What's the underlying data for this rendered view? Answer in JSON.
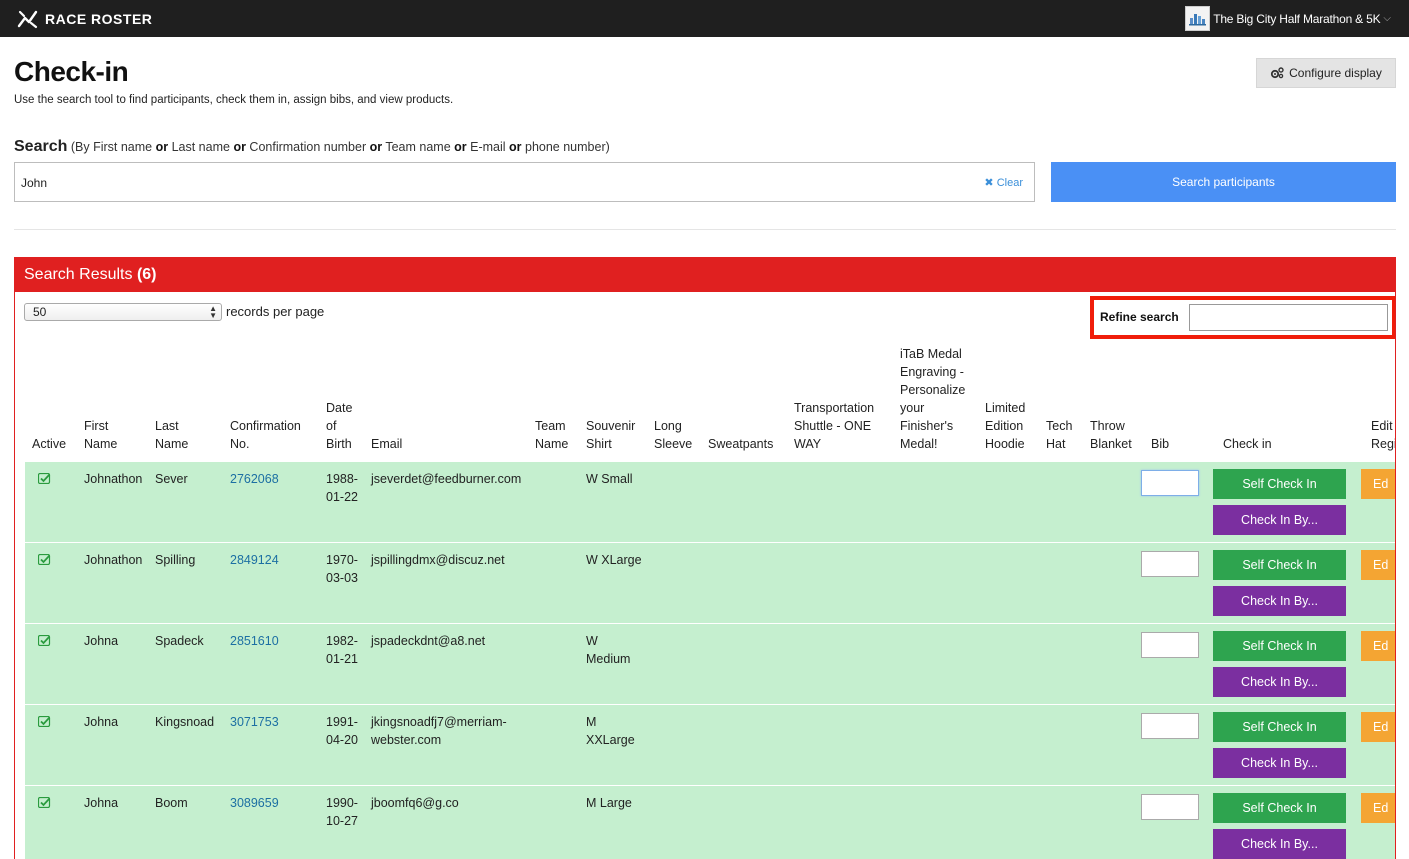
{
  "topbar": {
    "brand": "RACE ROSTER",
    "event_name": "The Big City Half Marathon & 5K",
    "caret": "⌵"
  },
  "header": {
    "title": "Check-in",
    "subtitle": "Use the search tool to find participants, check them in, assign bibs, and view products.",
    "configure_label": "Configure display"
  },
  "search": {
    "label": "Search",
    "hint_parts": [
      "(By First name ",
      "or",
      " Last name ",
      "or",
      " Confirmation number ",
      "or",
      " Team name ",
      "or",
      " E-mail ",
      "or",
      " phone number)"
    ],
    "value": "John",
    "clear_label": "Clear",
    "button_label": "Search participants"
  },
  "results": {
    "title": "Search Results",
    "count": "(6)",
    "per_page_value": "50",
    "per_page_label": "records per page",
    "refine_label": "Refine search",
    "refine_value": ""
  },
  "columns": {
    "active": "Active",
    "first_name": [
      "First",
      "Name"
    ],
    "last_name": [
      "Last",
      "Name"
    ],
    "confirmation": [
      "Confirmation",
      "No."
    ],
    "dob": [
      "Date",
      "of",
      "Birth"
    ],
    "email": "Email",
    "team_name": [
      "Team",
      "Name"
    ],
    "souvenir_shirt": [
      "Souvenir",
      "Shirt"
    ],
    "long_sleeve": [
      "Long",
      "Sleeve"
    ],
    "sweatpants": "Sweatpants",
    "transportation": [
      "Transportation",
      "Shuttle - ONE",
      "WAY"
    ],
    "itab_medal": [
      "iTaB Medal",
      "Engraving -",
      "Personalize",
      "your",
      "Finisher's",
      "Medal!"
    ],
    "limited_hoodie": [
      "Limited",
      "Edition",
      "Hoodie"
    ],
    "tech_hat": [
      "Tech",
      "Hat"
    ],
    "throw_blanket": [
      "Throw",
      "Blanket"
    ],
    "bib": "Bib",
    "check_in": "Check in",
    "edit_reg": [
      "Edit",
      "Regi"
    ]
  },
  "buttons": {
    "self_check_in": "Self Check In",
    "check_in_by": "Check In By...",
    "edit": "Ed"
  },
  "rows": [
    {
      "first": "Johnathon",
      "last": "Sever",
      "conf": "2762068",
      "dob": [
        "1988-",
        "01-22"
      ],
      "email": [
        "jseverdet@feedburner.com"
      ],
      "shirt": [
        "W Small"
      ]
    },
    {
      "first": "Johnathon",
      "last": "Spilling",
      "conf": "2849124",
      "dob": [
        "1970-",
        "03-03"
      ],
      "email": [
        "jspillingdmx@discuz.net"
      ],
      "shirt": [
        "W XLarge"
      ]
    },
    {
      "first": "Johna",
      "last": "Spadeck",
      "conf": "2851610",
      "dob": [
        "1982-",
        "01-21"
      ],
      "email": [
        "jspadeckdnt@a8.net"
      ],
      "shirt": [
        "W",
        "Medium"
      ]
    },
    {
      "first": "Johna",
      "last": "Kingsnoad",
      "conf": "3071753",
      "dob": [
        "1991-",
        "04-20"
      ],
      "email": [
        "jkingsnoadfj7@merriam-",
        "webster.com"
      ],
      "shirt": [
        "M",
        "XXLarge"
      ]
    },
    {
      "first": "Johna",
      "last": "Boom",
      "conf": "3089659",
      "dob": [
        "1990-",
        "10-27"
      ],
      "email": [
        "jboomfq6@g.co"
      ],
      "shirt": [
        "M Large"
      ]
    }
  ],
  "colors": {
    "topbar": "#1f1f1f",
    "results_header": "#e02020",
    "row_bg": "#c5efcf",
    "search_button": "#4a90f5",
    "self_check_in": "#2ea44f",
    "check_in_by": "#7b2fa0",
    "edit": "#f4a533",
    "link": "#1c6fa3"
  }
}
